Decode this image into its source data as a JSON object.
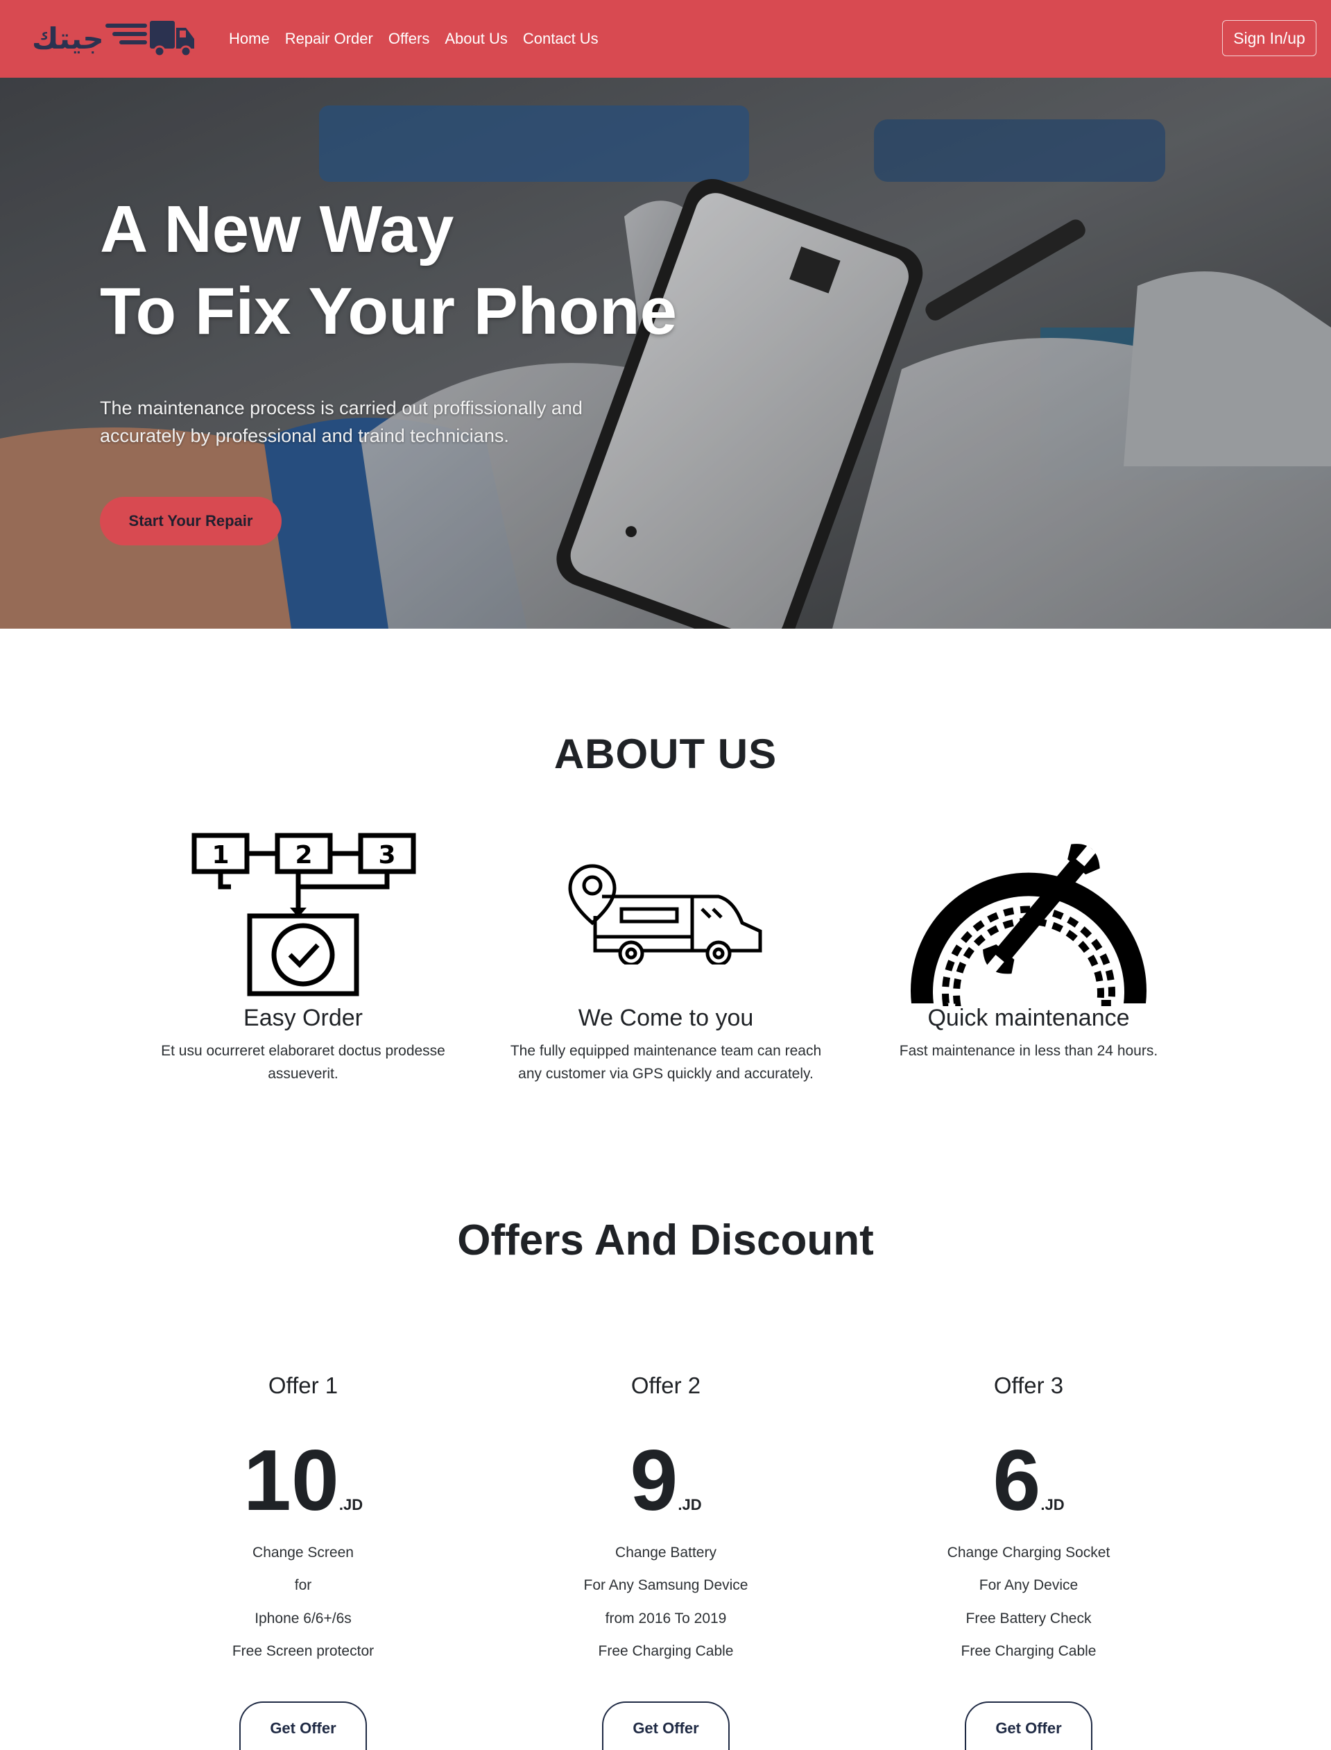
{
  "colors": {
    "brand": "#d84a51",
    "dark": "#1f2a44",
    "text": "#212529"
  },
  "nav": {
    "logo_text": "جيتك",
    "links": [
      "Home",
      "Repair Order",
      "Offers",
      "About Us",
      "Contact Us"
    ],
    "sign_in": "Sign In/up"
  },
  "hero": {
    "title_line1": "A New Way",
    "title_line2": "To Fix Your Phone",
    "text": "The maintenance process is carried out proffissionally and accurately by professional and traind technicians.",
    "button": "Start Your Repair"
  },
  "about": {
    "title": "ABOUT US",
    "items": [
      {
        "icon": "steps-checklist-icon",
        "heading": "Easy Order",
        "desc": "Et usu ocurreret elaboraret doctus prodesse assueverit."
      },
      {
        "icon": "delivery-truck-icon",
        "heading": "We Come to you",
        "desc": "The fully equipped maintenance team can reach any customer via GPS quickly and accurately."
      },
      {
        "icon": "speedometer-wrench-icon",
        "heading": "Quick maintenance",
        "desc": "Fast maintenance in less than 24 hours."
      }
    ]
  },
  "offers": {
    "title": "Offers And Discount",
    "currency": ".JD",
    "button": "Get Offer",
    "items": [
      {
        "name": "Offer 1",
        "price": "10",
        "lines": [
          "Change Screen",
          "for",
          "Iphone 6/6+/6s",
          "Free Screen protector"
        ]
      },
      {
        "name": "Offer 2",
        "price": "9",
        "lines": [
          "Change Battery",
          "For Any Samsung Device",
          "from 2016 To 2019",
          "Free Charging Cable"
        ]
      },
      {
        "name": "Offer 3",
        "price": "6",
        "lines": [
          "Change Charging Socket",
          "For Any Device",
          "Free Battery Check",
          "Free Charging Cable"
        ]
      }
    ]
  }
}
